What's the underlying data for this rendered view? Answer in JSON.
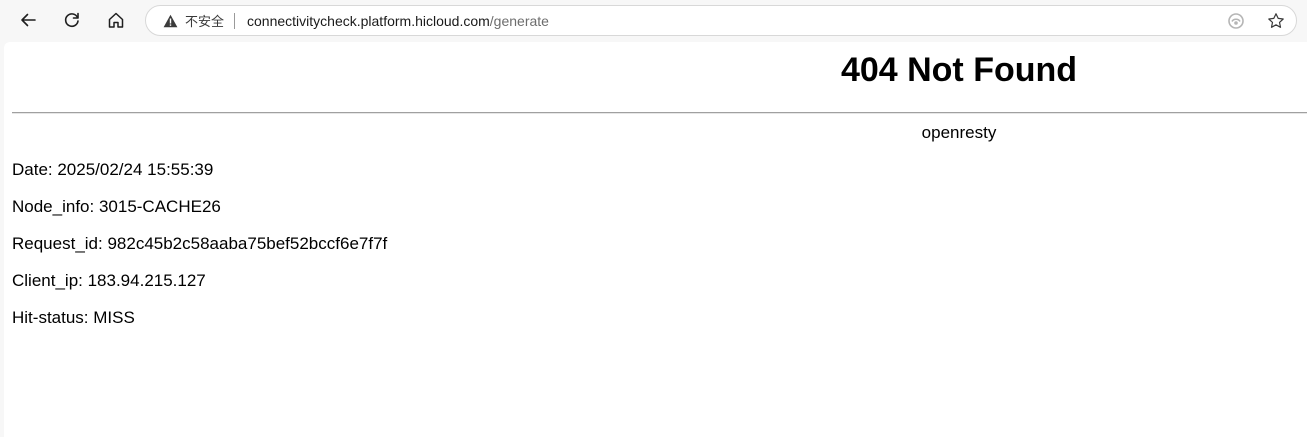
{
  "browser": {
    "security_label": "不安全",
    "url_host": "connectivitycheck.platform.hicloud.com",
    "url_path": "/generate",
    "icons": {
      "back": "arrow-left-icon",
      "reload": "reload-icon",
      "home": "home-icon",
      "security": "warning-triangle-icon",
      "immersive": "immersive-reader-icon",
      "favorite": "star-icon"
    }
  },
  "page": {
    "title": "404 Not Found",
    "server": "openresty",
    "info_lines": [
      "Date: 2025/02/24 15:55:39",
      "Node_info: 3015-CACHE26",
      "Request_id: 982c45b2c58aaba75bef52bccf6e7f7f",
      "Client_ip: 183.94.215.127",
      "Hit-status: MISS"
    ]
  }
}
